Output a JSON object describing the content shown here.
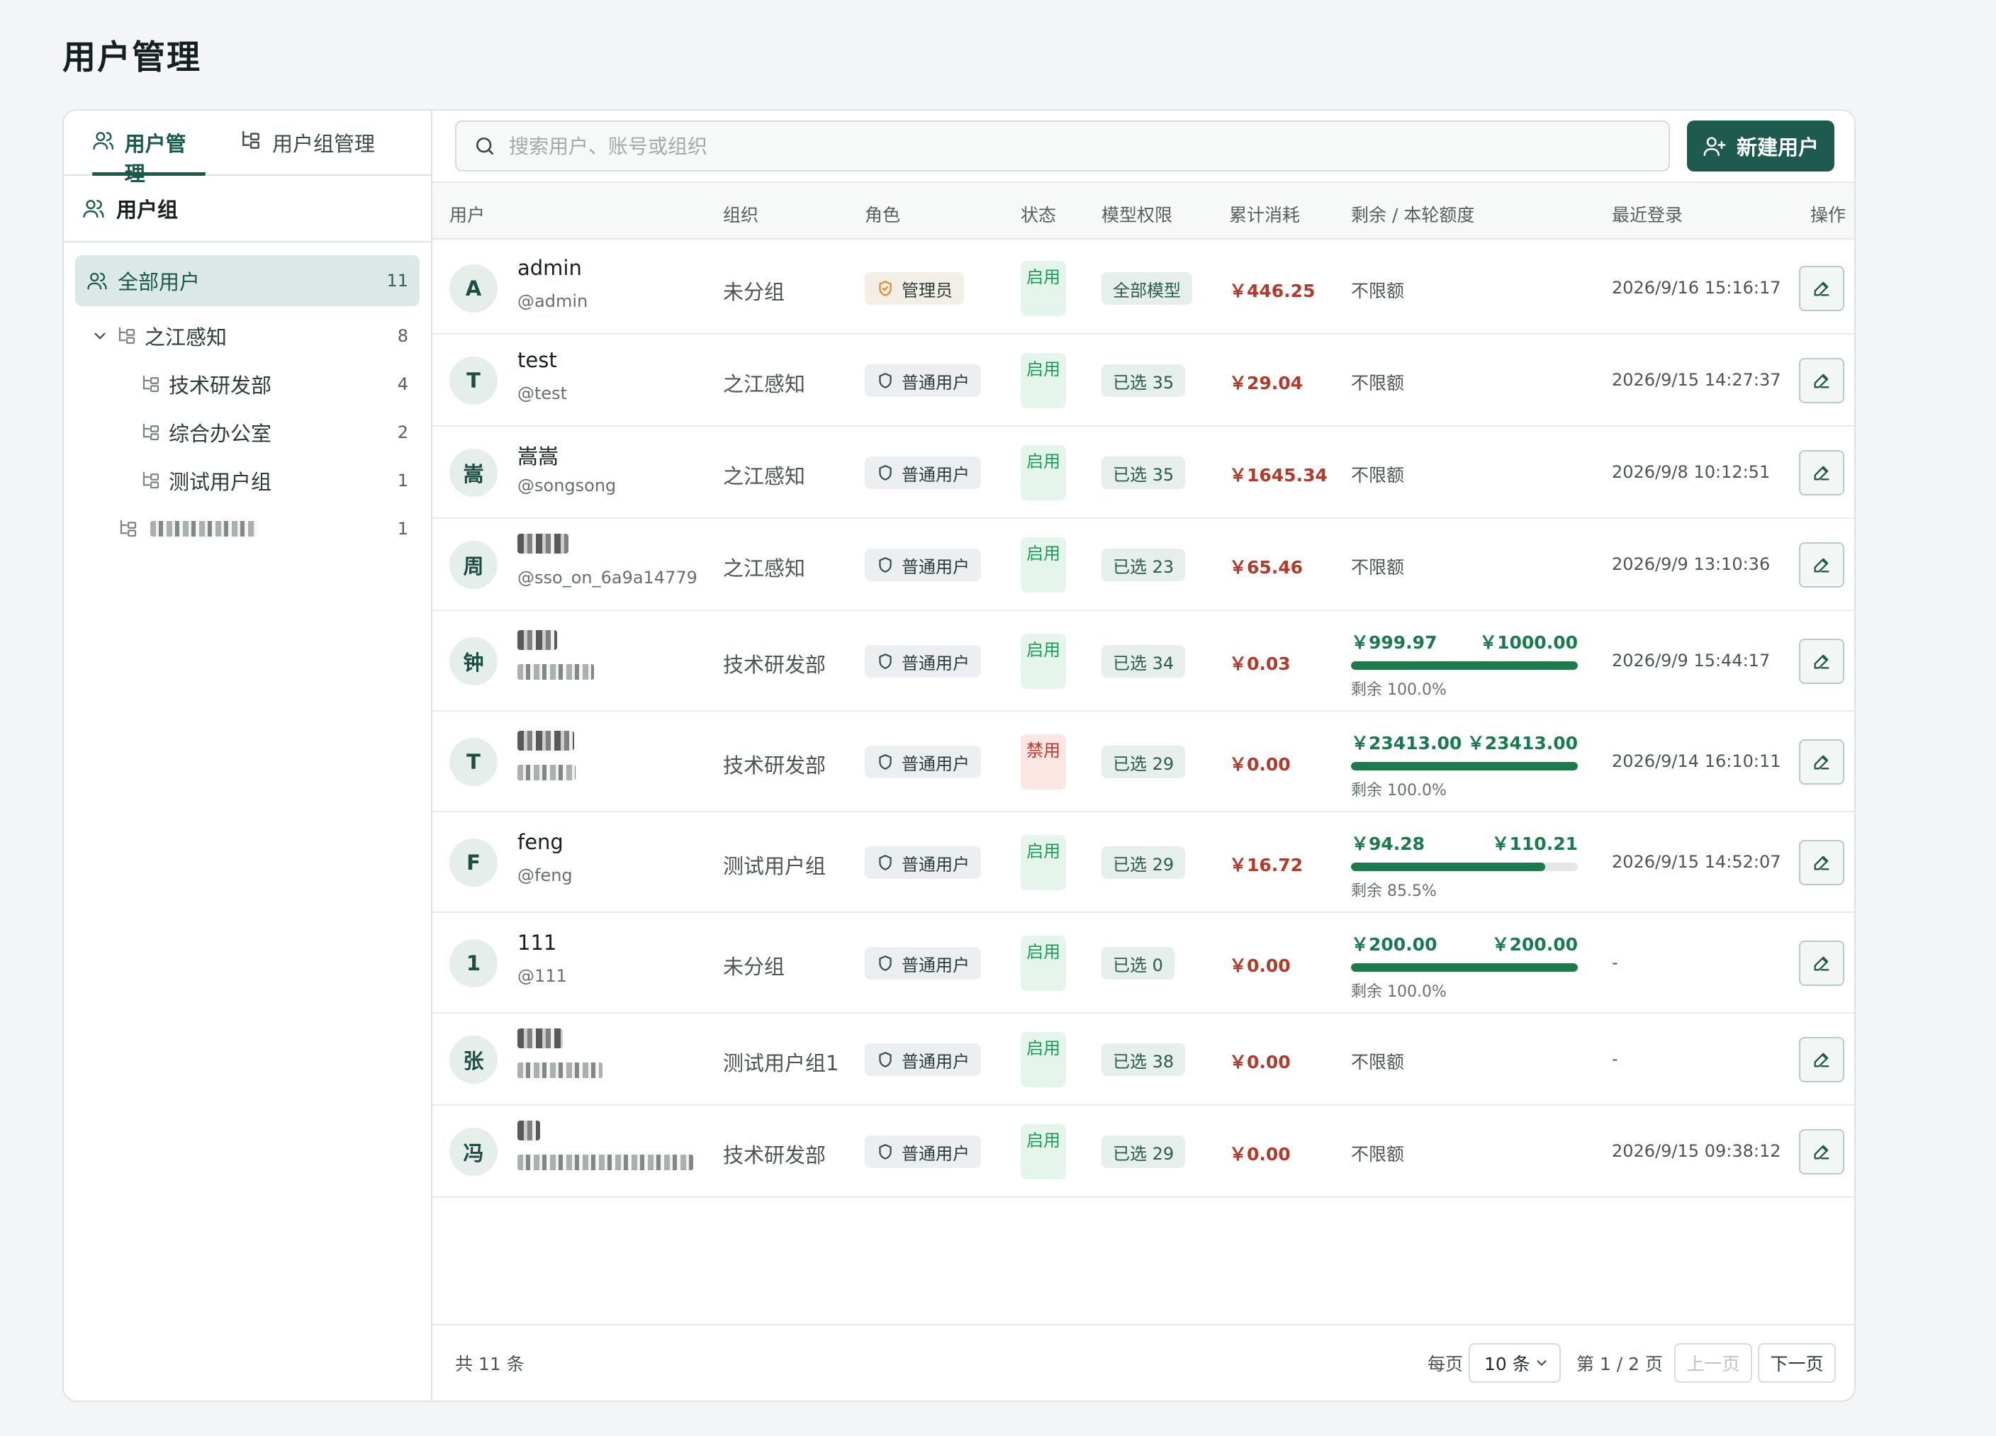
{
  "page": {
    "title": "用户管理"
  },
  "tabs": [
    {
      "label": "用户管理",
      "active": true
    },
    {
      "label": "用户组管理",
      "active": false
    }
  ],
  "sidebar": {
    "header": "用户组",
    "all": {
      "label": "全部用户",
      "count": "11"
    },
    "tree": [
      {
        "label": "之江感知",
        "count": "8",
        "level": 1,
        "expanded": true
      },
      {
        "label": "技术研发部",
        "count": "4",
        "level": 2
      },
      {
        "label": "综合办公室",
        "count": "2",
        "level": 2
      },
      {
        "label": "测试用户组",
        "count": "1",
        "level": 2
      },
      {
        "label": "",
        "count": "1",
        "level": 1,
        "blurred": true
      }
    ]
  },
  "search": {
    "placeholder": "搜索用户、账号或组织"
  },
  "new_user_button": "新建用户",
  "table": {
    "columns": [
      "用户",
      "组织",
      "角色",
      "状态",
      "模型权限",
      "累计消耗",
      "剩余 / 本轮额度",
      "最近登录",
      "操作"
    ],
    "rows": [
      {
        "avatar": "A",
        "name": "admin",
        "account": "@admin",
        "org": "未分组",
        "role": "管理员",
        "role_type": "admin",
        "status": "启用",
        "enabled": true,
        "perm": "全部模型",
        "cost": "￥446.25",
        "quota_text": "不限额",
        "last_login": "2026/9/16 15:16:17"
      },
      {
        "avatar": "T",
        "name": "test",
        "account": "@test",
        "org": "之江感知",
        "role": "普通用户",
        "role_type": "user",
        "status": "启用",
        "enabled": true,
        "perm": "已选 35",
        "cost": "￥29.04",
        "quota_text": "不限额",
        "last_login": "2026/9/15 14:27:37"
      },
      {
        "avatar": "嵩",
        "name": "嵩嵩",
        "account": "@songsong",
        "org": "之江感知",
        "role": "普通用户",
        "role_type": "user",
        "status": "启用",
        "enabled": true,
        "perm": "已选 35",
        "cost": "￥1645.34",
        "quota_text": "不限额",
        "last_login": "2026/9/8 10:12:51"
      },
      {
        "avatar": "周",
        "name": "",
        "account": "@sso_on_6a9a14779",
        "org": "之江感知",
        "role": "普通用户",
        "role_type": "user",
        "status": "启用",
        "enabled": true,
        "perm": "已选 23",
        "cost": "￥65.46",
        "quota_text": "不限额",
        "last_login": "2026/9/9 13:10:36",
        "blur_name": true
      },
      {
        "avatar": "钟",
        "name": "",
        "account": "",
        "org": "技术研发部",
        "role": "普通用户",
        "role_type": "user",
        "status": "启用",
        "enabled": true,
        "perm": "已选 34",
        "cost": "￥0.03",
        "quota": {
          "remain": "￥999.97",
          "total": "￥1000.00",
          "pct_label": "剩余 100.0%",
          "fraction": 1.0
        },
        "last_login": "2026/9/9 15:44:17",
        "blur_name": true,
        "blur_account": true
      },
      {
        "avatar": "T",
        "name": "",
        "account": "",
        "org": "技术研发部",
        "role": "普通用户",
        "role_type": "user",
        "status": "禁用",
        "enabled": false,
        "perm": "已选 29",
        "cost": "￥0.00",
        "quota": {
          "remain": "￥23413.00",
          "total": "￥23413.00",
          "pct_label": "剩余 100.0%",
          "fraction": 1.0
        },
        "last_login": "2026/9/14 16:10:11",
        "blur_name": true,
        "blur_account": true
      },
      {
        "avatar": "F",
        "name": "feng",
        "account": "@feng",
        "org": "测试用户组",
        "role": "普通用户",
        "role_type": "user",
        "status": "启用",
        "enabled": true,
        "perm": "已选 29",
        "cost": "￥16.72",
        "quota": {
          "remain": "￥94.28",
          "total": "￥110.21",
          "pct_label": "剩余 85.5%",
          "fraction": 0.855
        },
        "last_login": "2026/9/15 14:52:07"
      },
      {
        "avatar": "1",
        "name": "111",
        "account": "@111",
        "org": "未分组",
        "role": "普通用户",
        "role_type": "user",
        "status": "启用",
        "enabled": true,
        "perm": "已选 0",
        "cost": "￥0.00",
        "quota": {
          "remain": "￥200.00",
          "total": "￥200.00",
          "pct_label": "剩余 100.0%",
          "fraction": 1.0
        },
        "last_login": "-"
      },
      {
        "avatar": "张",
        "name": "",
        "account": "",
        "org": "测试用户组1",
        "role": "普通用户",
        "role_type": "user",
        "status": "启用",
        "enabled": true,
        "perm": "已选 38",
        "cost": "￥0.00",
        "quota_text": "不限额",
        "last_login": "-",
        "blur_name": true,
        "blur_account": true
      },
      {
        "avatar": "冯",
        "name": "",
        "account": "",
        "org": "技术研发部",
        "role": "普通用户",
        "role_type": "user",
        "status": "启用",
        "enabled": true,
        "perm": "已选 29",
        "cost": "￥0.00",
        "quota_text": "不限额",
        "last_login": "2026/9/15 09:38:12",
        "blur_name": true,
        "blur_account": true
      }
    ]
  },
  "footer": {
    "total": "共 11 条",
    "per_page_label": "每页",
    "per_page_value": "10 条",
    "page_info": "第 1 / 2 页",
    "prev": "上一页",
    "next": "下一页"
  },
  "colors": {
    "primary": "#1e5b4e",
    "accent_active": "#1a5a4c",
    "cost_red": "#b23a2a",
    "enabled_green": "#1e9a58",
    "disabled_red": "#c0392b"
  }
}
